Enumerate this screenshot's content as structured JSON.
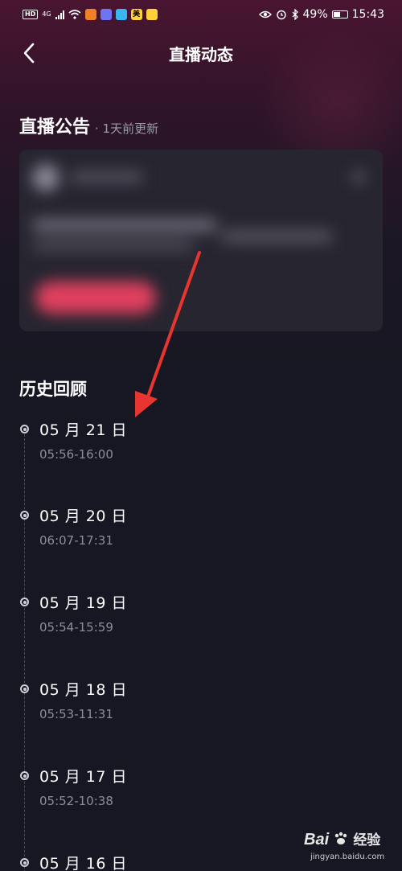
{
  "statusbar": {
    "hd": "HD",
    "net": "4G",
    "battery": "49%",
    "time": "15:43",
    "app_badge_mei": "美"
  },
  "header": {
    "title": "直播动态"
  },
  "announcement": {
    "title": "直播公告",
    "updated": "· 1天前更新"
  },
  "history": {
    "title": "历史回顾",
    "items": [
      {
        "date": "05 月 21 日",
        "time": "05:56-16:00"
      },
      {
        "date": "05 月 20 日",
        "time": "06:07-17:31"
      },
      {
        "date": "05 月 19 日",
        "time": "05:54-15:59"
      },
      {
        "date": "05 月 18 日",
        "time": "05:53-11:31"
      },
      {
        "date": "05 月 17 日",
        "time": "05:52-10:38"
      },
      {
        "date": "05 月 16 日",
        "time": ""
      }
    ]
  },
  "watermark": {
    "logo": "Bai",
    "logo_cn": "经验",
    "url": "jingyan.baidu.com"
  },
  "colors": {
    "background": "#161722",
    "header_gradient": "#4a1530",
    "arrow": "#e8352f",
    "button_pink": "#e0405f"
  }
}
